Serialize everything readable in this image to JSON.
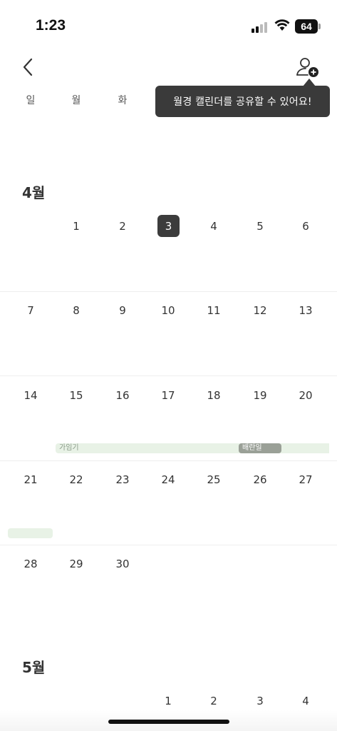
{
  "status_bar": {
    "time": "1:23",
    "battery": "64"
  },
  "tooltip": {
    "text": "월경 캘린더를 공유할 수 있어요!"
  },
  "weekdays": [
    "일",
    "월",
    "화"
  ],
  "months": [
    {
      "title": "4월",
      "weeks": [
        [
          "",
          "1",
          "2",
          "3",
          "4",
          "5",
          "6"
        ],
        [
          "7",
          "8",
          "9",
          "10",
          "11",
          "12",
          "13"
        ],
        [
          "14",
          "15",
          "16",
          "17",
          "18",
          "19",
          "20"
        ],
        [
          "21",
          "22",
          "23",
          "24",
          "25",
          "26",
          "27"
        ],
        [
          "28",
          "29",
          "30",
          "",
          "",
          "",
          ""
        ]
      ],
      "today": "3"
    },
    {
      "title": "5월",
      "weeks": [
        [
          "",
          "",
          "",
          "1",
          "2",
          "3",
          "4"
        ]
      ]
    }
  ],
  "events": {
    "fertile": {
      "label": "가임기",
      "color": "#e8f2e6"
    },
    "ovulation": {
      "label": "배란일",
      "color": "#9aa097"
    }
  },
  "icons": {
    "back": "chevron-left-icon",
    "add_member": "person-add-icon"
  }
}
